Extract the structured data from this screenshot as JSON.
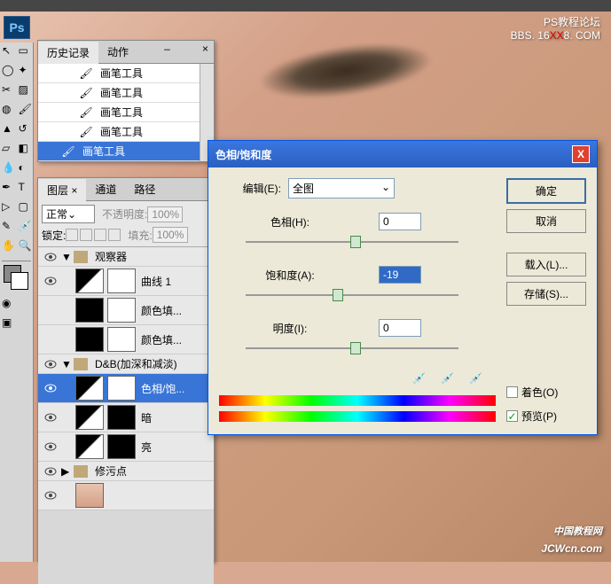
{
  "watermark": {
    "top_line1": "PS教程论坛",
    "top_line2_pre": "BBS. 16",
    "top_line2_mid": "XX",
    "top_line2_post": "8. COM",
    "bottom_sub": "中国教程网",
    "bottom_main": "JCWcn.com"
  },
  "ps_badge": "Ps",
  "history": {
    "tabs": [
      "历史记录",
      "动作"
    ],
    "close": "×",
    "items": [
      "画笔工具",
      "画笔工具",
      "画笔工具",
      "画笔工具",
      "画笔工具"
    ]
  },
  "layers": {
    "tabs": [
      "图层",
      "通道",
      "路径"
    ],
    "close": "×",
    "blend_mode": "正常",
    "opacity_label": "不透明度:",
    "opacity_value": "100%",
    "lock_label": "锁定:",
    "fill_label": "填充:",
    "fill_value": "100%",
    "groups": [
      {
        "name": "观察器",
        "expanded": true,
        "layers": [
          {
            "name": "曲线 1",
            "thumb": "curves",
            "mask": "white"
          },
          {
            "name": "颜色填...",
            "thumb": "black",
            "mask": "white"
          },
          {
            "name": "颜色填...",
            "thumb": "black",
            "mask": "white"
          }
        ]
      },
      {
        "name": "D&B(加深和减淡)",
        "expanded": true,
        "layers": [
          {
            "name": "色相/饱...",
            "thumb": "curves",
            "mask": "white",
            "selected": true
          },
          {
            "name": "暗",
            "thumb": "curves",
            "mask": "black"
          },
          {
            "name": "亮",
            "thumb": "curves",
            "mask": "black"
          }
        ]
      },
      {
        "name": "修污点",
        "expanded": false,
        "layers": []
      }
    ]
  },
  "dialog": {
    "title": "色相/饱和度",
    "close": "X",
    "edit_label": "编辑(E):",
    "edit_value": "全图",
    "hue_label": "色相(H):",
    "hue_value": "0",
    "sat_label": "饱和度(A):",
    "sat_value": "-19",
    "light_label": "明度(I):",
    "light_value": "0",
    "btn_ok": "确定",
    "btn_cancel": "取消",
    "btn_load": "载入(L)...",
    "btn_save": "存储(S)...",
    "colorize_label": "着色(O)",
    "preview_label": "预览(P)",
    "preview_checked": "✓"
  }
}
